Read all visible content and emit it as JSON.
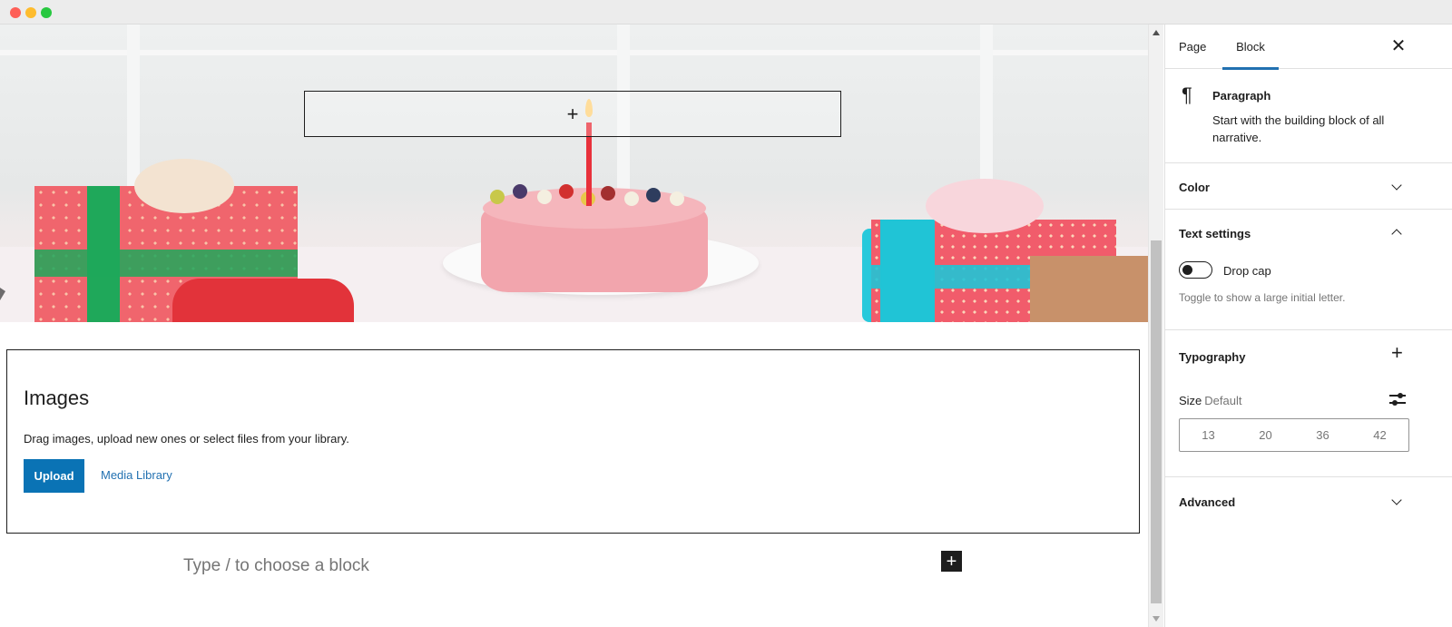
{
  "window": {
    "controls": [
      "close",
      "minimize",
      "maximize"
    ]
  },
  "cover": {
    "inserter_icon": "plus-icon"
  },
  "images_block": {
    "title": "Images",
    "help": "Drag images, upload new ones or select files from your library.",
    "upload_label": "Upload",
    "media_library_label": "Media Library"
  },
  "editor": {
    "prompt": "Type / to choose a block",
    "inserter_symbol": "+"
  },
  "sidebar": {
    "tabs": [
      {
        "label": "Page"
      },
      {
        "label": "Block",
        "active": true
      }
    ],
    "close_symbol": "✕",
    "block_card": {
      "icon": "paragraph-icon",
      "title": "Paragraph",
      "description": "Start with the building block of all narrative."
    },
    "sections": {
      "color": {
        "title": "Color",
        "expanded": false
      },
      "text_settings": {
        "title": "Text settings",
        "expanded": true,
        "drop_cap_label": "Drop cap",
        "drop_cap_on": false,
        "drop_cap_help": "Toggle to show a large initial letter."
      },
      "typography": {
        "title": "Typography",
        "add_symbol": "+",
        "size_label": "Size",
        "size_value": "Default",
        "size_options": [
          "13",
          "20",
          "36",
          "42"
        ]
      },
      "advanced": {
        "title": "Advanced",
        "expanded": false
      }
    }
  },
  "colors": {
    "accent": "#2271b1",
    "upload_button": "#0a73b5",
    "text": "#1e1e1e",
    "muted": "#757575"
  }
}
